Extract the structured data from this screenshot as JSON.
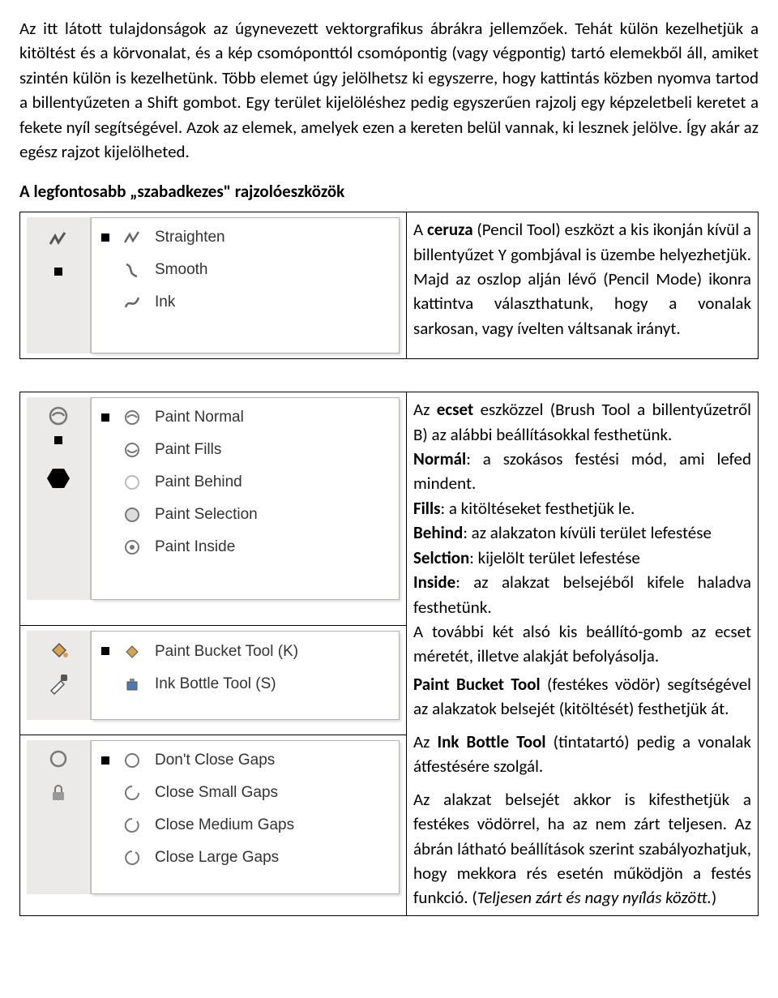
{
  "intro": "Az itt látott tulajdonságok az úgynevezett vektorgrafikus ábrákra jellemzőek. Tehát külön kezelhetjük a kitöltést és a körvonalat, és a kép csomóponttól csomópontig (vagy végpontig) tartó elemekből áll, amiket szintén külön is kezelhetünk. Több elemet úgy jelölhetsz ki egyszerre, hogy kattintás közben nyomva tartod a billentyűzeten a Shift gombot. Egy terület kijelöléshez pedig egyszerűen rajzolj egy képzeletbeli keretet a fekete nyíl segítségével. Azok az elemek, amelyek ezen a kereten belül vannak, ki lesznek jelölve. Így akár az egész rajzot kijelölheted.",
  "subhead": "A legfontosabb „szabadkezes\" rajzolóeszközök",
  "pencil": {
    "items": [
      "Straighten",
      "Smooth",
      "Ink"
    ],
    "desc_pre": "A ",
    "desc_bold": "ceruza",
    "desc": " (Pencil Tool) eszközt a kis ikonján kívül a billentyűzet Y gombjával is üzembe helyezhetjük. Majd az oszlop alján lévő (Pencil Mode) ikonra kattintva választhatunk, hogy a vonalak sarkosan, vagy ívelten váltsanak irányt."
  },
  "brush": {
    "items": [
      "Paint Normal",
      "Paint Fills",
      "Paint Behind",
      "Paint Selection",
      "Paint Inside"
    ],
    "desc_pre": "Az ",
    "desc_bold": "ecset",
    "desc1": " eszközzel (Brush Tool a billentyűzetről B) az alábbi beállításokkal festhetünk.",
    "normal_label": "Normál",
    "normal": ": a szokásos festési mód, ami lefed mindent.",
    "fills_label": "Fills",
    "fills": ": a kitöltéseket festhetjük le.",
    "behind_label": "Behind",
    "behind": ": az alakzaton kívüli terület lefestése",
    "sel_label": "Selction",
    "sel": ": kijelölt terület lefestése",
    "inside_label": "Inside",
    "inside": ": az alakzat belsejéből kifele haladva festhetünk.",
    "more": "A további két alsó kis beállító-gomb az ecset méretét, illetve alakját befolyásolja."
  },
  "bucket": {
    "items": [
      "Paint Bucket Tool (K)",
      "Ink Bottle Tool (S)"
    ],
    "pb_label": "Paint Bucket Tool",
    "pb": " (festékes vödör) segítségével az alakzatok belsejét (kitöltését) festhetjük át.",
    "ib_pre": "Az ",
    "ib_label": "Ink Bottle Tool",
    "ib": " (tintatartó) pedig a vonalak átfestésére szolgál.",
    "gap_intro": "Az alakzat belsejét akkor is kifesthetjük a festékes vödörrel, ha az nem zárt teljesen. Az ábrán látható beállítások szerint szabályozhatjuk, hogy mekkora rés esetén működjön a festés funkció. (",
    "gap_ital": "Teljesen zárt és nagy nyílás között.",
    "gap_close": ")"
  },
  "gaps": {
    "items": [
      "Don't Close Gaps",
      "Close Small Gaps",
      "Close Medium Gaps",
      "Close Large Gaps"
    ]
  }
}
